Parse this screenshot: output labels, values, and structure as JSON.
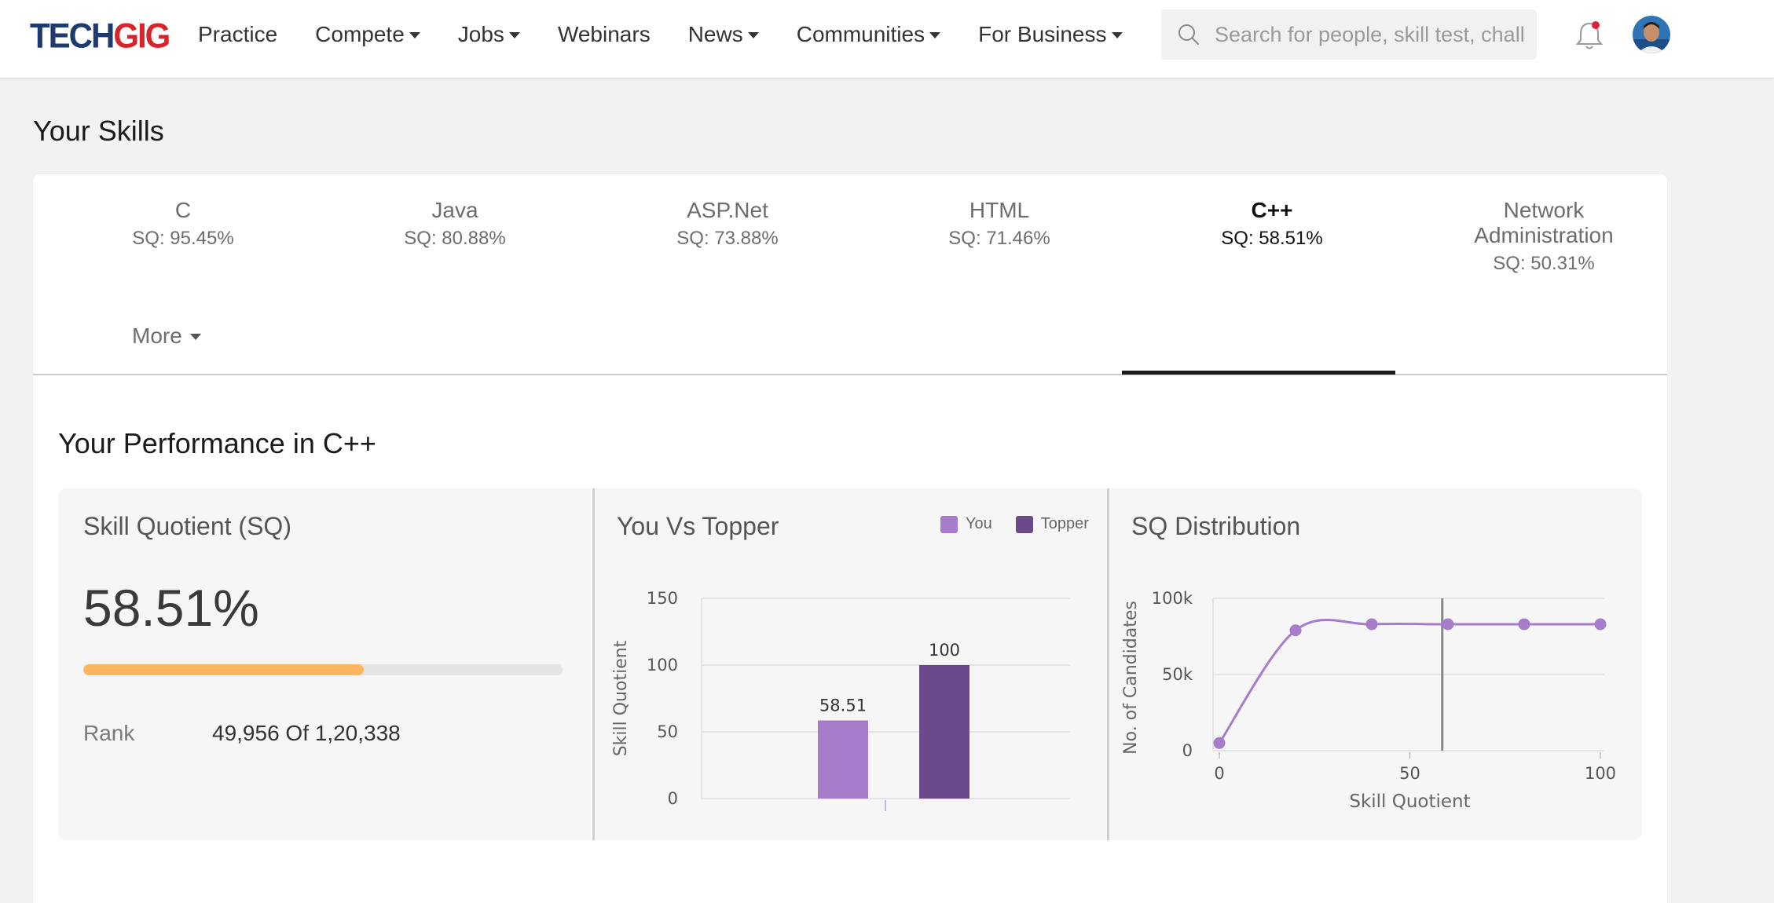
{
  "header": {
    "logo_part1": "TECH",
    "logo_part2": "GIG",
    "nav": [
      {
        "label": "Practice",
        "dropdown": false
      },
      {
        "label": "Compete",
        "dropdown": true
      },
      {
        "label": "Jobs",
        "dropdown": true
      },
      {
        "label": "Webinars",
        "dropdown": false
      },
      {
        "label": "News",
        "dropdown": true
      },
      {
        "label": "Communities",
        "dropdown": true
      },
      {
        "label": "For Business",
        "dropdown": true
      }
    ],
    "search_placeholder": "Search for people, skill test, chall",
    "notification_dot_color": "#e0203b"
  },
  "page": {
    "title": "Your Skills"
  },
  "skills": {
    "tabs": [
      {
        "name": "C",
        "sq": "SQ: 95.45%"
      },
      {
        "name": "Java",
        "sq": "SQ: 80.88%"
      },
      {
        "name": "ASP.Net",
        "sq": "SQ: 73.88%"
      },
      {
        "name": "HTML",
        "sq": "SQ: 71.46%"
      },
      {
        "name": "C++",
        "sq": "SQ: 58.51%"
      },
      {
        "name": "Network Administration",
        "sq": "SQ: 50.31%"
      }
    ],
    "active_index": 4,
    "more_label": "More"
  },
  "performance": {
    "title": "Your Performance in C++",
    "sq_panel": {
      "title": "Skill Quotient (SQ)",
      "value": "58.51%",
      "progress_fraction": 0.5851,
      "progress_color": "#ffb55e",
      "rank_label": "Rank",
      "rank_value": "49,956 Of 1,20,338"
    },
    "vs_panel": {
      "title": "You Vs Topper",
      "legend": [
        {
          "label": "You",
          "color": "#a67ccb"
        },
        {
          "label": "Topper",
          "color": "#6a4a8a"
        }
      ]
    },
    "dist_panel": {
      "title": "SQ Distribution"
    }
  },
  "chart_data": [
    {
      "type": "bar",
      "title": "You Vs Topper",
      "ylabel": "Skill Quotient",
      "xlabel": "",
      "ylim": [
        0,
        150
      ],
      "yticks": [
        0,
        50,
        100,
        150
      ],
      "categories": [
        "You",
        "Topper"
      ],
      "values": [
        58.51,
        100
      ],
      "data_labels": [
        "58.51",
        "100"
      ],
      "colors": [
        "#a67ccb",
        "#6a4a8a"
      ],
      "grid": true,
      "legend": "top-right"
    },
    {
      "type": "line",
      "title": "SQ Distribution",
      "xlabel": "Skill Quotient",
      "ylabel": "No. of Candidates",
      "xlim": [
        0,
        100
      ],
      "ylim": [
        0,
        100000
      ],
      "xticks": [
        0,
        50,
        100
      ],
      "xtick_labels": [
        "0",
        "50",
        "100"
      ],
      "yticks": [
        0,
        50000,
        100000
      ],
      "ytick_labels": [
        "0",
        "50k",
        "100k"
      ],
      "x": [
        0,
        20,
        40,
        60,
        80,
        100
      ],
      "y": [
        5000,
        79000,
        83000,
        83000,
        83000,
        83000
      ],
      "marker_x": 58.51,
      "color": "#a67ccb",
      "grid": true
    }
  ]
}
